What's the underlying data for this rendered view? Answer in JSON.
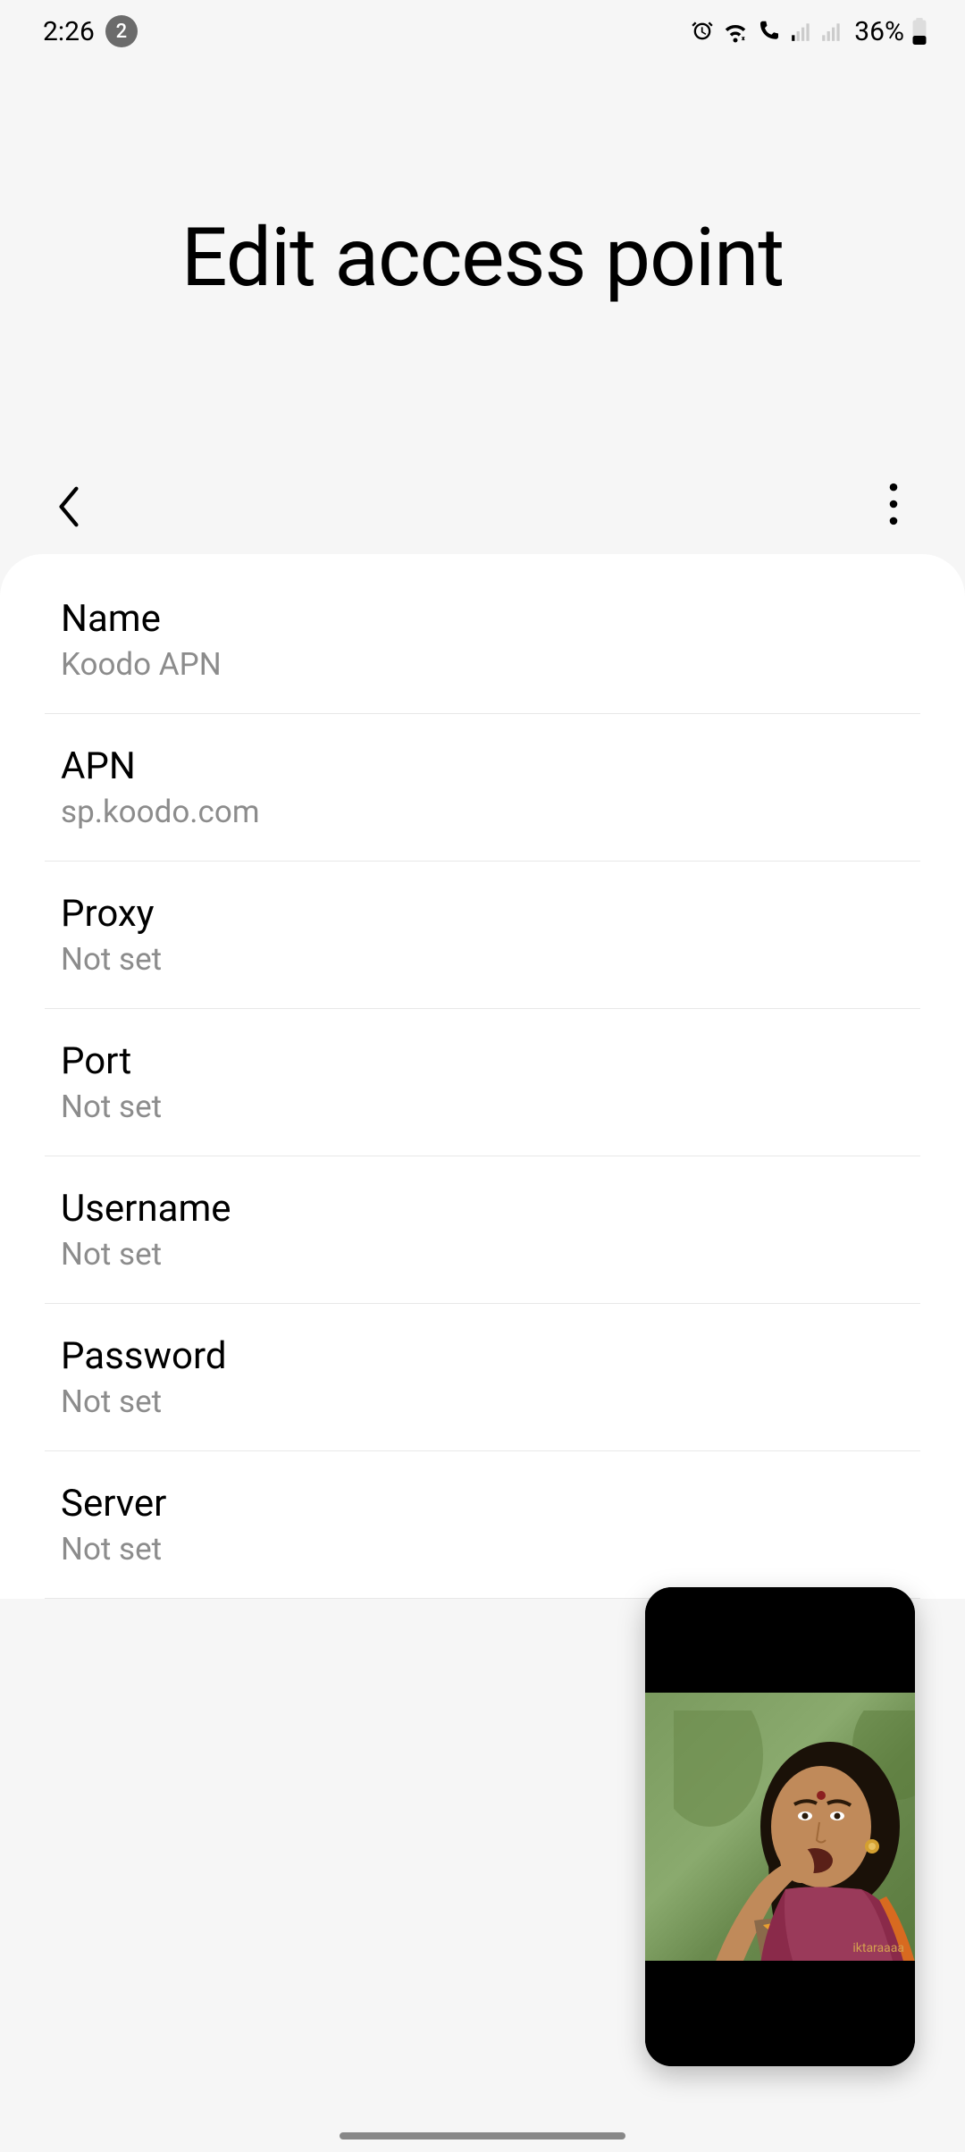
{
  "statusbar": {
    "time": "2:26",
    "notification_count": "2",
    "battery_pct": "36%"
  },
  "header": {
    "title": "Edit access point"
  },
  "settings": [
    {
      "label": "Name",
      "value": "Koodo APN"
    },
    {
      "label": "APN",
      "value": "sp.koodo.com"
    },
    {
      "label": "Proxy",
      "value": "Not set"
    },
    {
      "label": "Port",
      "value": "Not set"
    },
    {
      "label": "Username",
      "value": "Not set"
    },
    {
      "label": "Password",
      "value": "Not set"
    },
    {
      "label": "Server",
      "value": "Not set"
    }
  ],
  "pip": {
    "watermark": "iktaraaaa"
  }
}
